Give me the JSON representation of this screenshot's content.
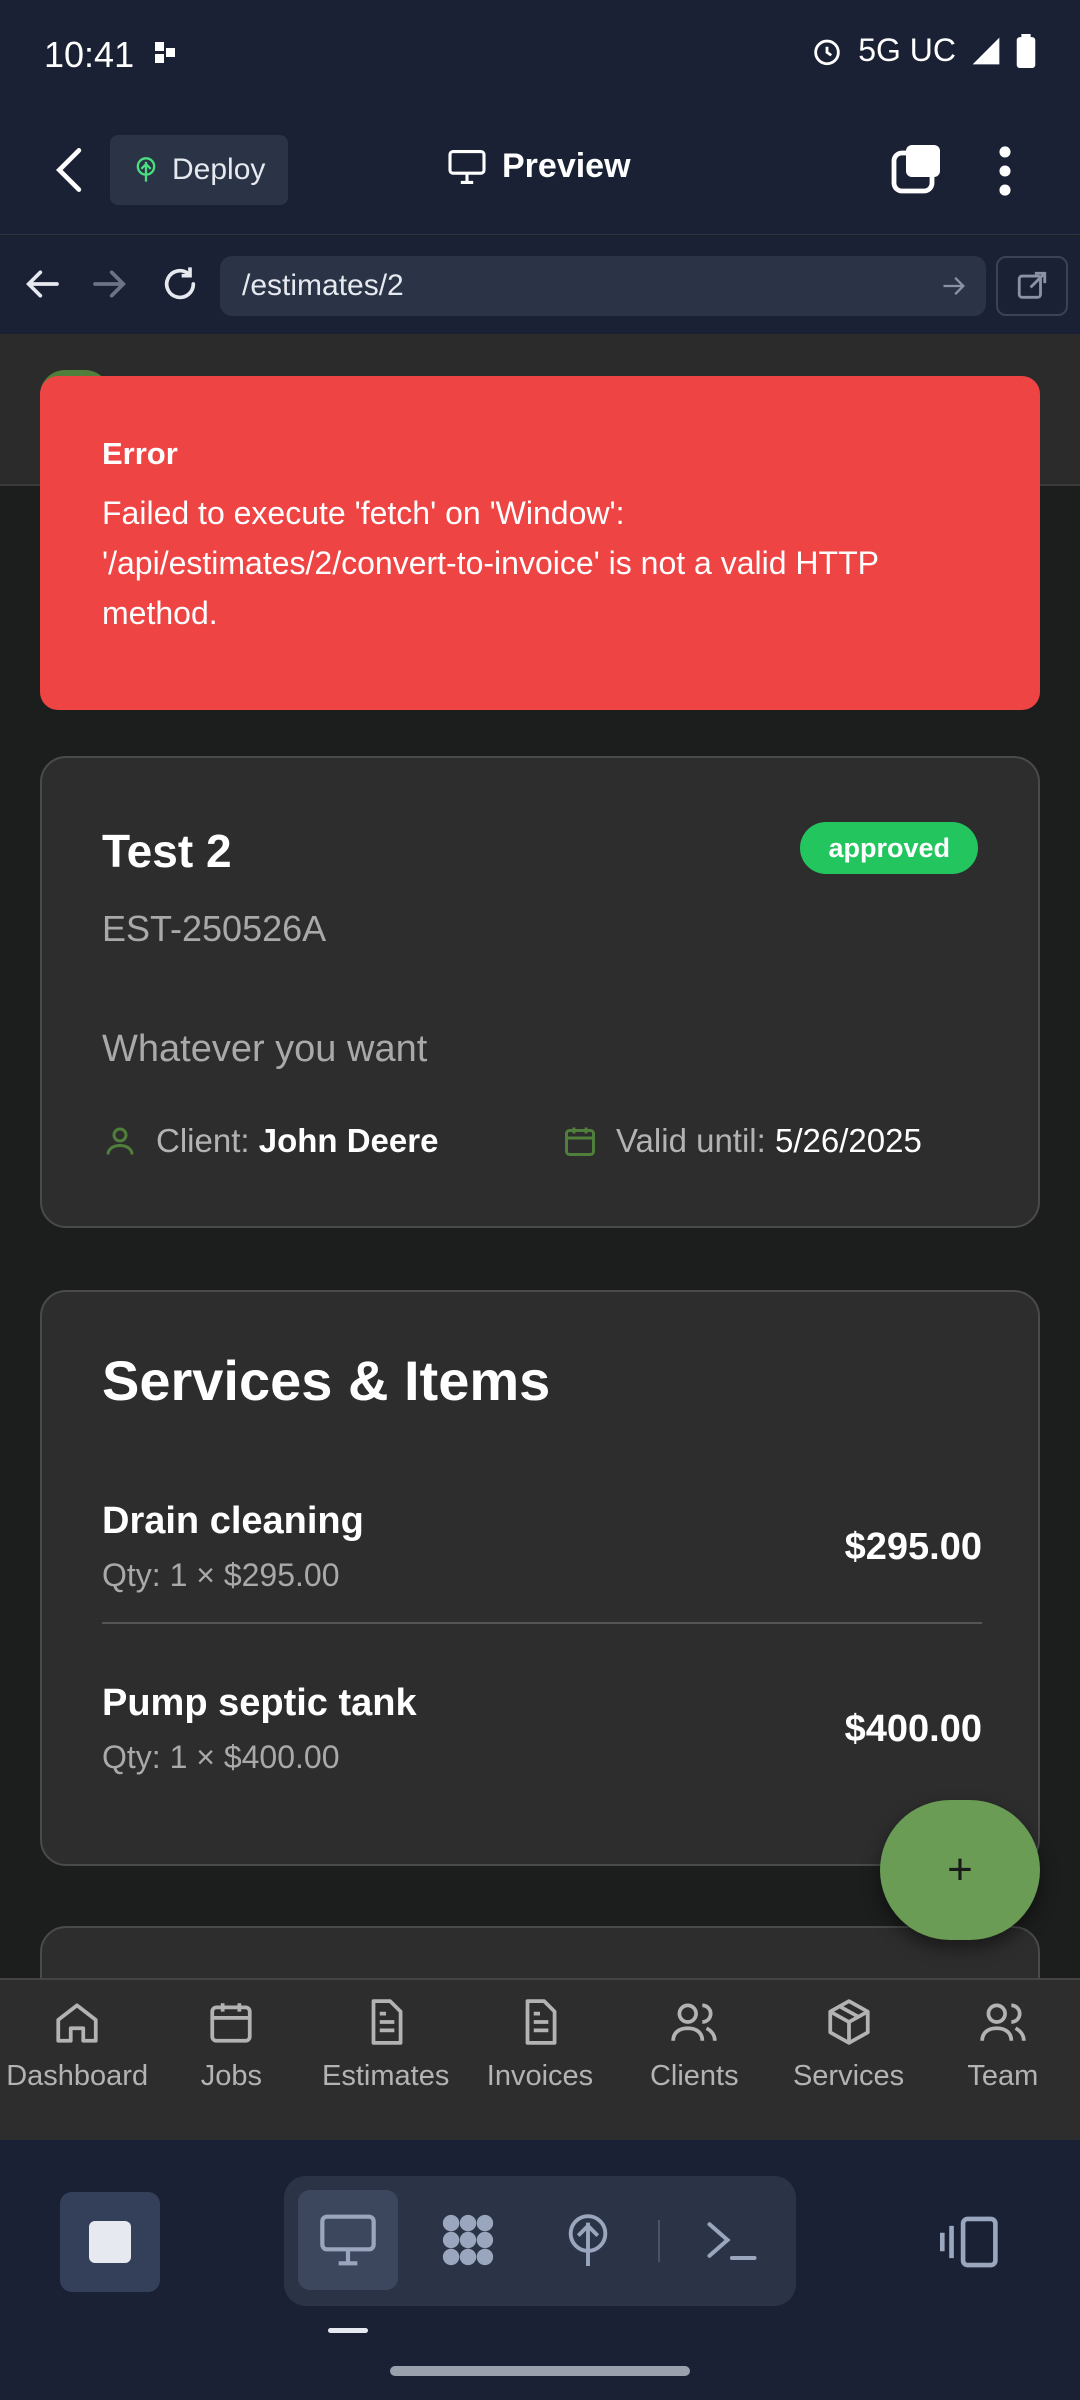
{
  "status_bar": {
    "time": "10:41",
    "network": "5G UC"
  },
  "app_header": {
    "deploy_label": "Deploy",
    "preview_label": "Preview"
  },
  "browser": {
    "url": "/estimates/2"
  },
  "error": {
    "title": "Error",
    "message": "Failed to execute 'fetch' on 'Window': '/api/estimates/2/convert-to-invoice' is not a valid HTTP method."
  },
  "estimate": {
    "title": "Test 2",
    "status": "approved",
    "number": "EST-250526A",
    "description": "Whatever you want",
    "client_label": "Client:",
    "client_name": "John Deere",
    "valid_label": "Valid until:",
    "valid_date": "5/26/2025"
  },
  "services": {
    "title": "Services & Items",
    "items": [
      {
        "name": "Drain cleaning",
        "qty": "Qty: 1 × $295.00",
        "amount": "$295.00"
      },
      {
        "name": "Pump septic tank",
        "qty": "Qty: 1 × $400.00",
        "amount": "$400.00"
      }
    ]
  },
  "fab": {
    "label": "+"
  },
  "bottom_nav": [
    {
      "label": "Dashboard",
      "icon": "home-icon"
    },
    {
      "label": "Jobs",
      "icon": "calendar-icon"
    },
    {
      "label": "Estimates",
      "icon": "document-icon"
    },
    {
      "label": "Invoices",
      "icon": "document-icon"
    },
    {
      "label": "Clients",
      "icon": "users-icon"
    },
    {
      "label": "Services",
      "icon": "package-icon"
    },
    {
      "label": "Team",
      "icon": "users-icon"
    }
  ],
  "colors": {
    "chrome_bg": "#1a2134",
    "error_bg": "#ef4444",
    "badge_approved": "#22c55e",
    "fab": "#6a9c55",
    "card_bg": "#2d2d2d"
  }
}
